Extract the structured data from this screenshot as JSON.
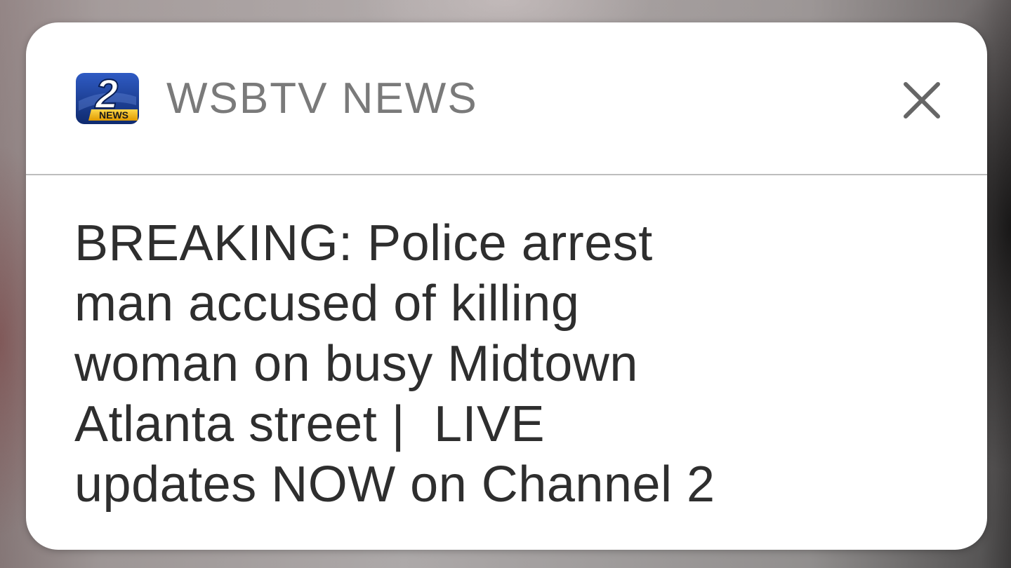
{
  "notification": {
    "app_name": "WSBTV NEWS",
    "logo": {
      "icon": "channel-2-news-logo-icon",
      "numeral": "2",
      "wordmark": "NEWS"
    },
    "close_icon": "close-icon",
    "message_lines": [
      "BREAKING: Police arrest",
      "man accused of killing",
      "woman on busy Midtown",
      "Atlanta street |  LIVE",
      "updates NOW on Channel 2"
    ]
  },
  "colors": {
    "card_background": "#ffffff",
    "app_name_text": "#7a7a7a",
    "body_text": "#2e2e2e",
    "divider": "#bdbdbd",
    "logo_blue": "#1c3d8f",
    "logo_gold": "#f2b705"
  }
}
